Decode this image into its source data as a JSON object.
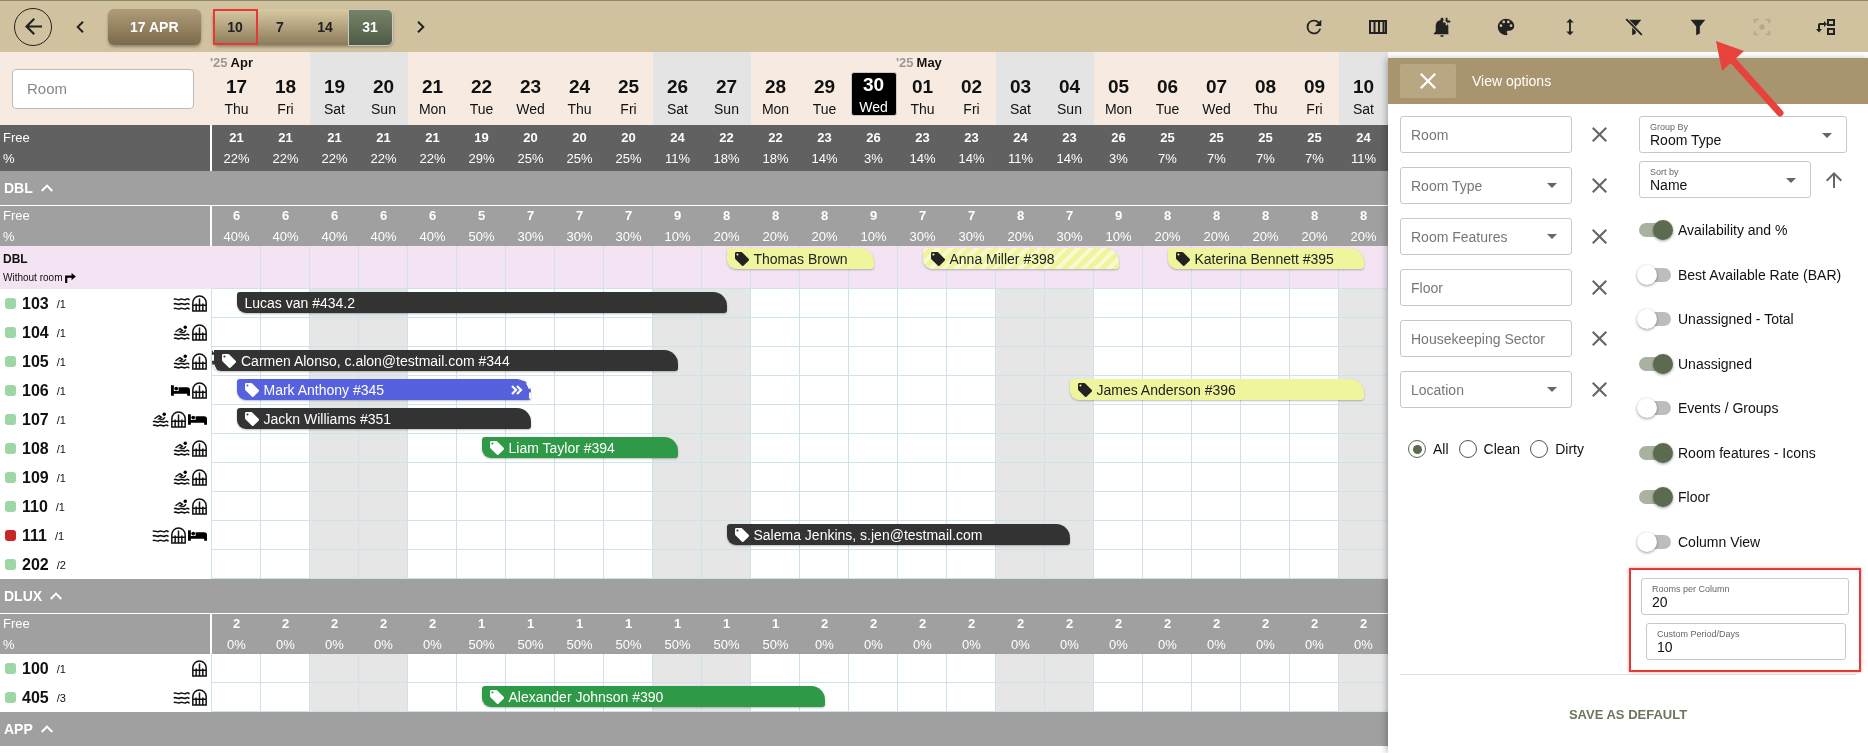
{
  "toolbar": {
    "date": "17 APR",
    "period_options": [
      {
        "label": "10",
        "selected": false,
        "highlighted": true
      },
      {
        "label": "7",
        "selected": false,
        "highlighted": false
      },
      {
        "label": "14",
        "selected": false,
        "highlighted": false
      },
      {
        "label": "31",
        "selected": true,
        "highlighted": false
      }
    ],
    "actions": [
      {
        "kind": "refresh",
        "disabled": false,
        "pointed": false
      },
      {
        "kind": "columns",
        "disabled": false,
        "pointed": false
      },
      {
        "kind": "bell-plus",
        "disabled": false,
        "pointed": false
      },
      {
        "kind": "palette",
        "disabled": false,
        "pointed": false
      },
      {
        "kind": "height",
        "disabled": false,
        "pointed": false
      },
      {
        "kind": "filter-off",
        "disabled": false,
        "pointed": false
      },
      {
        "kind": "filter",
        "disabled": false,
        "pointed": true
      },
      {
        "kind": "focus",
        "disabled": true,
        "pointed": false
      },
      {
        "kind": "swap",
        "disabled": false,
        "pointed": false
      }
    ]
  },
  "room_search": {
    "placeholder": "Room"
  },
  "days": [
    {
      "year": "'25",
      "month": "Apr",
      "day": "17",
      "weekday": "Thu",
      "weekend": false,
      "selected": false
    },
    {
      "day": "18",
      "weekday": "Fri",
      "weekend": false,
      "selected": false
    },
    {
      "day": "19",
      "weekday": "Sat",
      "weekend": true,
      "selected": false
    },
    {
      "day": "20",
      "weekday": "Sun",
      "weekend": true,
      "selected": false
    },
    {
      "day": "21",
      "weekday": "Mon",
      "weekend": false,
      "selected": false
    },
    {
      "day": "22",
      "weekday": "Tue",
      "weekend": false,
      "selected": false
    },
    {
      "day": "23",
      "weekday": "Wed",
      "weekend": false,
      "selected": false
    },
    {
      "day": "24",
      "weekday": "Thu",
      "weekend": false,
      "selected": false
    },
    {
      "day": "25",
      "weekday": "Fri",
      "weekend": false,
      "selected": false
    },
    {
      "day": "26",
      "weekday": "Sat",
      "weekend": true,
      "selected": false
    },
    {
      "day": "27",
      "weekday": "Sun",
      "weekend": true,
      "selected": false
    },
    {
      "day": "28",
      "weekday": "Mon",
      "weekend": false,
      "selected": false
    },
    {
      "day": "29",
      "weekday": "Tue",
      "weekend": false,
      "selected": false
    },
    {
      "day": "30",
      "weekday": "Wed",
      "weekend": false,
      "selected": true
    },
    {
      "year": "'25",
      "month": "May",
      "day": "01",
      "weekday": "Thu",
      "weekend": false,
      "selected": false
    },
    {
      "day": "02",
      "weekday": "Fri",
      "weekend": false,
      "selected": false
    },
    {
      "day": "03",
      "weekday": "Sat",
      "weekend": true,
      "selected": false
    },
    {
      "day": "04",
      "weekday": "Sun",
      "weekend": true,
      "selected": false
    },
    {
      "day": "05",
      "weekday": "Mon",
      "weekend": false,
      "selected": false
    },
    {
      "day": "06",
      "weekday": "Tue",
      "weekend": false,
      "selected": false
    },
    {
      "day": "07",
      "weekday": "Wed",
      "weekend": false,
      "selected": false
    },
    {
      "day": "08",
      "weekday": "Thu",
      "weekend": false,
      "selected": false
    },
    {
      "day": "09",
      "weekday": "Fri",
      "weekend": false,
      "selected": false
    },
    {
      "day": "10",
      "weekday": "Sat",
      "weekend": true,
      "selected": false
    }
  ],
  "totals": {
    "free_label": "Free",
    "percent_label": "%",
    "free": [
      "21",
      "21",
      "21",
      "21",
      "21",
      "19",
      "20",
      "20",
      "20",
      "24",
      "22",
      "22",
      "23",
      "26",
      "23",
      "23",
      "24",
      "23",
      "26",
      "25",
      "25",
      "25",
      "25",
      "24"
    ],
    "percent": [
      "22%",
      "22%",
      "22%",
      "22%",
      "22%",
      "29%",
      "25%",
      "25%",
      "25%",
      "11%",
      "18%",
      "18%",
      "14%",
      "3%",
      "14%",
      "14%",
      "11%",
      "14%",
      "3%",
      "7%",
      "7%",
      "7%",
      "7%",
      "11%"
    ]
  },
  "groups": [
    {
      "name": "DBL",
      "expanded": true,
      "free_label": "Free",
      "percent_label": "%",
      "free": [
        "6",
        "6",
        "6",
        "6",
        "6",
        "5",
        "7",
        "7",
        "7",
        "9",
        "8",
        "8",
        "8",
        "9",
        "7",
        "7",
        "8",
        "7",
        "9",
        "8",
        "8",
        "8",
        "8",
        "8"
      ],
      "percent": [
        "40%",
        "40%",
        "40%",
        "40%",
        "40%",
        "50%",
        "30%",
        "30%",
        "30%",
        "10%",
        "20%",
        "20%",
        "20%",
        "10%",
        "30%",
        "30%",
        "20%",
        "30%",
        "10%",
        "20%",
        "20%",
        "20%",
        "20%",
        "20%"
      ],
      "unassigned": {
        "name": "DBL",
        "label": "Without room",
        "timeline": [
          {
            "kind": "free"
          },
          {
            "kind": "free"
          },
          {
            "kind": "free"
          },
          {
            "kind": "free"
          },
          {
            "kind": "free"
          },
          {
            "kind": "free"
          },
          {
            "kind": "free"
          },
          {
            "kind": "free"
          },
          {
            "kind": "free"
          },
          {
            "kind": "free"
          },
          {
            "kind": "in",
            "booking": {
              "guest": "Thomas Brown",
              "color": "#eff59c",
              "tagged": true,
              "striped": false,
              "extended": false
            }
          },
          {
            "kind": "stay"
          },
          {
            "kind": "stay"
          },
          {
            "kind": "out"
          },
          {
            "kind": "in",
            "booking": {
              "guest": "Anna Miller #398",
              "color": "#eff59c",
              "tagged": true,
              "striped": true,
              "extended": false
            }
          },
          {
            "kind": "stay"
          },
          {
            "kind": "stay"
          },
          {
            "kind": "stay"
          },
          {
            "kind": "out"
          },
          {
            "kind": "in",
            "booking": {
              "guest": "Katerina Bennett #395",
              "color": "#eff59c",
              "tagged": true,
              "striped": false,
              "extended": false
            }
          },
          {
            "kind": "stay"
          },
          {
            "kind": "stay"
          },
          {
            "kind": "stay"
          },
          {
            "kind": "out"
          }
        ]
      },
      "rooms": [
        {
          "number": "103",
          "floor": "/1",
          "color": "#9ed6a5",
          "features": [
            {
              "kind": "waves"
            },
            {
              "kind": "arch"
            }
          ],
          "timeline": [
            {
              "kind": "in",
              "booking": {
                "guest": "Lucas van #434.2",
                "color": "#333333",
                "tagged": false,
                "striped": false,
                "extended": false
              }
            },
            {
              "kind": "stay"
            },
            {
              "kind": "stay"
            },
            {
              "kind": "stay"
            },
            {
              "kind": "stay"
            },
            {
              "kind": "stay"
            },
            {
              "kind": "stay"
            },
            {
              "kind": "stay"
            },
            {
              "kind": "stay"
            },
            {
              "kind": "stay"
            },
            {
              "kind": "out"
            }
          ]
        },
        {
          "number": "104",
          "floor": "/1",
          "color": "#9ed6a5",
          "features": [
            {
              "kind": "swim"
            },
            {
              "kind": "arch"
            }
          ]
        },
        {
          "number": "105",
          "floor": "/1",
          "color": "#9ed6a5",
          "features": [
            {
              "kind": "swim"
            },
            {
              "kind": "arch"
            }
          ],
          "timeline": [
            {
              "kind": "continued",
              "booking": {
                "guest": "Carmen Alonso, c.alon@testmail.com #344",
                "color": "#333333",
                "tagged": true,
                "striped": false,
                "extended": false
              }
            },
            {
              "kind": "stay"
            },
            {
              "kind": "stay"
            },
            {
              "kind": "stay"
            },
            {
              "kind": "stay"
            },
            {
              "kind": "stay"
            },
            {
              "kind": "stay"
            },
            {
              "kind": "stay"
            },
            {
              "kind": "stay"
            },
            {
              "kind": "out"
            }
          ]
        },
        {
          "number": "106",
          "floor": "/1",
          "color": "#9ed6a5",
          "features": [
            {
              "kind": "bed"
            },
            {
              "kind": "arch"
            }
          ],
          "timeline": [
            {
              "kind": "in",
              "booking": {
                "guest": "Mark Anthony #345",
                "color": "#5561dd",
                "tagged": true,
                "striped": false,
                "extended": true
              }
            },
            {
              "kind": "stay"
            },
            {
              "kind": "stay"
            },
            {
              "kind": "stay"
            },
            {
              "kind": "stay"
            },
            {
              "kind": "stay"
            },
            {
              "kind": "out"
            },
            {
              "kind": "free"
            },
            {
              "kind": "free"
            },
            {
              "kind": "free"
            },
            {
              "kind": "free"
            },
            {
              "kind": "free"
            },
            {
              "kind": "free"
            },
            {
              "kind": "free"
            },
            {
              "kind": "free"
            },
            {
              "kind": "free"
            },
            {
              "kind": "free"
            },
            {
              "kind": "in",
              "booking": {
                "guest": "James Anderson #396",
                "color": "#eff59c",
                "tagged": true,
                "striped": false,
                "extended": false
              }
            },
            {
              "kind": "stay"
            },
            {
              "kind": "stay"
            },
            {
              "kind": "stay"
            },
            {
              "kind": "stay"
            },
            {
              "kind": "stay"
            },
            {
              "kind": "out"
            }
          ]
        },
        {
          "number": "107",
          "floor": "/1",
          "color": "#9ed6a5",
          "features": [
            {
              "kind": "swim"
            },
            {
              "kind": "arch"
            },
            {
              "kind": "bed"
            }
          ],
          "timeline": [
            {
              "kind": "in",
              "booking": {
                "guest": "Jackn Williams #351",
                "color": "#333333",
                "tagged": true,
                "striped": false,
                "extended": false
              }
            },
            {
              "kind": "stay"
            },
            {
              "kind": "stay"
            },
            {
              "kind": "stay"
            },
            {
              "kind": "stay"
            },
            {
              "kind": "stay"
            },
            {
              "kind": "out"
            }
          ]
        },
        {
          "number": "108",
          "floor": "/1",
          "color": "#9ed6a5",
          "features": [
            {
              "kind": "swim"
            },
            {
              "kind": "arch"
            }
          ],
          "timeline": [
            {
              "kind": "free"
            },
            {
              "kind": "free"
            },
            {
              "kind": "free"
            },
            {
              "kind": "free"
            },
            {
              "kind": "free"
            },
            {
              "kind": "in",
              "booking": {
                "guest": "Liam Taylor #394",
                "color": "#2e9a47",
                "tagged": true,
                "striped": false,
                "extended": false
              }
            },
            {
              "kind": "stay"
            },
            {
              "kind": "stay"
            },
            {
              "kind": "stay"
            },
            {
              "kind": "out"
            }
          ]
        },
        {
          "number": "109",
          "floor": "/1",
          "color": "#9ed6a5",
          "features": [
            {
              "kind": "swim"
            },
            {
              "kind": "arch"
            }
          ]
        },
        {
          "number": "110",
          "floor": "/1",
          "color": "#9ed6a5",
          "features": [
            {
              "kind": "swim"
            },
            {
              "kind": "arch"
            }
          ]
        },
        {
          "number": "111",
          "floor": "/1",
          "color": "#c62828",
          "features": [
            {
              "kind": "waves"
            },
            {
              "kind": "arch"
            },
            {
              "kind": "bed"
            }
          ],
          "timeline": [
            {
              "kind": "free"
            },
            {
              "kind": "free"
            },
            {
              "kind": "free"
            },
            {
              "kind": "free"
            },
            {
              "kind": "free"
            },
            {
              "kind": "free"
            },
            {
              "kind": "free"
            },
            {
              "kind": "free"
            },
            {
              "kind": "free"
            },
            {
              "kind": "free"
            },
            {
              "kind": "in",
              "booking": {
                "guest": "Salema Jenkins, s.jen@testmail.com",
                "color": "#333333",
                "tagged": true,
                "striped": false,
                "extended": false
              }
            },
            {
              "kind": "stay"
            },
            {
              "kind": "stay"
            },
            {
              "kind": "stay"
            },
            {
              "kind": "stay"
            },
            {
              "kind": "stay"
            },
            {
              "kind": "stay"
            },
            {
              "kind": "out"
            }
          ]
        },
        {
          "number": "202",
          "floor": "/2",
          "color": "#9ed6a5"
        }
      ]
    },
    {
      "name": "DLUX",
      "expanded": true,
      "free_label": "Free",
      "percent_label": "%",
      "free": [
        "2",
        "2",
        "2",
        "2",
        "2",
        "1",
        "1",
        "1",
        "1",
        "1",
        "1",
        "1",
        "2",
        "2",
        "2",
        "2",
        "2",
        "2",
        "2",
        "2",
        "2",
        "2",
        "2",
        "2"
      ],
      "percent": [
        "0%",
        "0%",
        "0%",
        "0%",
        "0%",
        "50%",
        "50%",
        "50%",
        "50%",
        "50%",
        "50%",
        "50%",
        "0%",
        "0%",
        "0%",
        "0%",
        "0%",
        "0%",
        "0%",
        "0%",
        "0%",
        "0%",
        "0%",
        "0%"
      ],
      "rooms": [
        {
          "number": "100",
          "floor": "/1",
          "color": "#9ed6a5",
          "features": [
            {
              "kind": "arch"
            }
          ]
        },
        {
          "number": "405",
          "floor": "/3",
          "color": "#9ed6a5",
          "features": [
            {
              "kind": "waves"
            },
            {
              "kind": "arch"
            }
          ],
          "timeline": [
            {
              "kind": "free"
            },
            {
              "kind": "free"
            },
            {
              "kind": "free"
            },
            {
              "kind": "free"
            },
            {
              "kind": "free"
            },
            {
              "kind": "in",
              "booking": {
                "guest": "Alexander Johnson #390",
                "color": "#2e9a47",
                "tagged": true,
                "striped": false,
                "extended": false
              }
            },
            {
              "kind": "stay"
            },
            {
              "kind": "stay"
            },
            {
              "kind": "stay"
            },
            {
              "kind": "stay"
            },
            {
              "kind": "stay"
            },
            {
              "kind": "stay"
            },
            {
              "kind": "out"
            }
          ]
        }
      ]
    },
    {
      "name": "APP",
      "expanded": true
    }
  ],
  "panel": {
    "title": "View options",
    "filters": [
      {
        "kind": "text",
        "placeholder": "Room"
      },
      {
        "kind": "select",
        "placeholder": "Room Type"
      },
      {
        "kind": "select",
        "placeholder": "Room Features"
      },
      {
        "kind": "text",
        "placeholder": "Floor"
      },
      {
        "kind": "text",
        "placeholder": "Housekeeping Sector"
      },
      {
        "kind": "select",
        "placeholder": "Location"
      }
    ],
    "housekeeping": [
      {
        "label": "All",
        "selected": true
      },
      {
        "label": "Clean",
        "selected": false
      },
      {
        "label": "Dirty",
        "selected": false
      }
    ],
    "group_by": {
      "label": "Group By",
      "value": "Room Type"
    },
    "sort_by": {
      "label": "Sort by",
      "value": "Name"
    },
    "toggles": [
      {
        "label": "Availability and %",
        "on": true
      },
      {
        "label": "Best Available Rate (BAR)",
        "on": false
      },
      {
        "label": "Unassigned - Total",
        "on": false
      },
      {
        "label": "Unassigned",
        "on": true
      },
      {
        "label": "Events / Groups",
        "on": false
      },
      {
        "label": "Room features - Icons",
        "on": true
      },
      {
        "label": "Floor",
        "on": true
      },
      {
        "label": "Column View",
        "on": false
      }
    ],
    "numbers": {
      "highlighted": true,
      "fields": [
        {
          "label": "Rooms per Column",
          "value": "20"
        },
        {
          "label": "Custom Period/Days",
          "value": "10"
        }
      ]
    },
    "save": "SAVE AS DEFAULT"
  }
}
